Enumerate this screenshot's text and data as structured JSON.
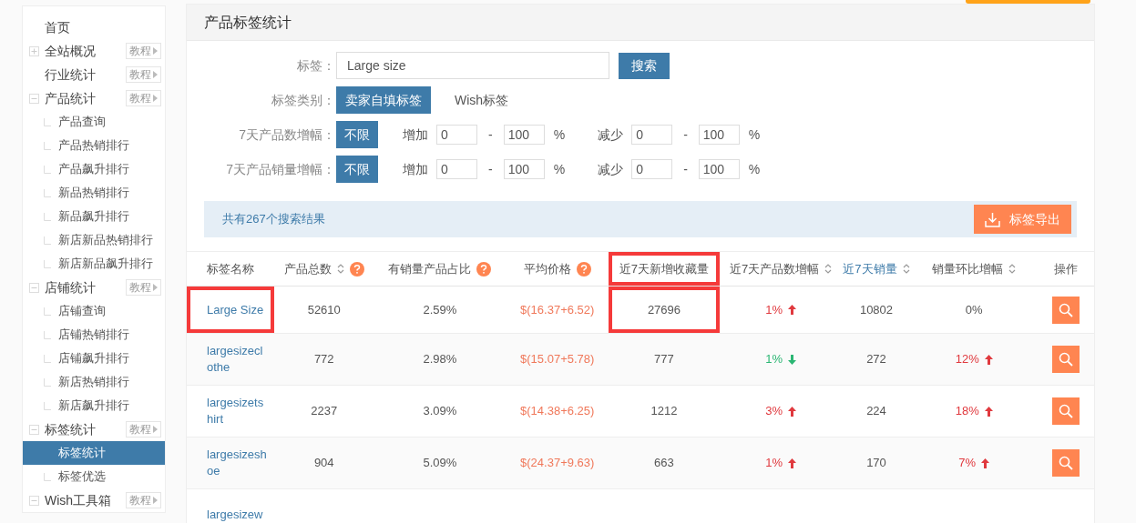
{
  "sidebar": {
    "items": [
      {
        "label": "首页",
        "selected": false
      },
      {
        "label": "全站概况",
        "expanded": false,
        "tutorial": "教程",
        "selected": false
      },
      {
        "label": "行业统计",
        "tutorial": "教程",
        "selected": false
      },
      {
        "label": "产品统计",
        "expanded": true,
        "tutorial": "教程",
        "selected": false,
        "children": [
          {
            "label": "产品查询",
            "selected": false
          },
          {
            "label": "产品热销排行",
            "selected": false
          },
          {
            "label": "产品飙升排行",
            "selected": false
          },
          {
            "label": "新品热销排行",
            "selected": false
          },
          {
            "label": "新品飙升排行",
            "selected": false
          },
          {
            "label": "新店新品热销排行",
            "selected": false
          },
          {
            "label": "新店新品飙升排行",
            "selected": false
          }
        ]
      },
      {
        "label": "店铺统计",
        "expanded": true,
        "tutorial": "教程",
        "selected": false,
        "children": [
          {
            "label": "店铺查询",
            "selected": false
          },
          {
            "label": "店铺热销排行",
            "selected": false
          },
          {
            "label": "店铺飙升排行",
            "selected": false
          },
          {
            "label": "新店热销排行",
            "selected": false
          },
          {
            "label": "新店飙升排行",
            "selected": false
          }
        ]
      },
      {
        "label": "标签统计",
        "expanded": true,
        "tutorial": "教程",
        "selected": false,
        "children": [
          {
            "label": "标签统计",
            "selected": true
          },
          {
            "label": "标签优选",
            "selected": false
          }
        ]
      },
      {
        "label": "Wish工具箱",
        "expanded": true,
        "tutorial": "教程",
        "selected": false
      }
    ]
  },
  "panel": {
    "title": "产品标签统计",
    "filters": {
      "tag_label": "标签：",
      "tag_value": "Large size",
      "search_button": "搜索",
      "category_label": "标签类别：",
      "categories": [
        {
          "label": "卖家自填标签",
          "selected": true
        },
        {
          "label": "Wish标签",
          "selected": false
        }
      ],
      "ranges": [
        {
          "label": "7天产品数增幅：",
          "unlimited": "不限",
          "unlimited_selected": true,
          "increase": "增加",
          "inc_from": "0",
          "inc_to": "100",
          "decrease": "减少",
          "dec_from": "0",
          "dec_to": "100",
          "dash": "-",
          "unit": "%"
        },
        {
          "label": "7天产品销量增幅：",
          "unlimited": "不限",
          "unlimited_selected": true,
          "increase": "增加",
          "inc_from": "0",
          "inc_to": "100",
          "decrease": "减少",
          "dec_from": "0",
          "dec_to": "100",
          "dash": "-",
          "unit": "%"
        }
      ]
    },
    "result_text": "共有267个搜索结果",
    "export_button": "标签导出",
    "table": {
      "columns": [
        {
          "label": "标签名称",
          "sortable": false,
          "help": false,
          "selected": false,
          "highlighted": false
        },
        {
          "label": "产品总数",
          "sortable": true,
          "help": true,
          "selected": false,
          "highlighted": false
        },
        {
          "label": "有销量产品占比",
          "sortable": false,
          "help": true,
          "selected": false,
          "highlighted": false
        },
        {
          "label": "平均价格",
          "sortable": false,
          "help": true,
          "selected": false,
          "highlighted": false
        },
        {
          "label": "近7天新增收藏量",
          "sortable": false,
          "help": false,
          "selected": false,
          "highlighted": true
        },
        {
          "label": "近7天产品数增幅",
          "sortable": true,
          "help": false,
          "selected": false,
          "highlighted": false
        },
        {
          "label": "近7天销量",
          "sortable": true,
          "help": false,
          "selected": true,
          "highlighted": false
        },
        {
          "label": "销量环比增幅",
          "sortable": true,
          "help": false,
          "selected": false,
          "highlighted": false
        },
        {
          "label": "操作",
          "sortable": false,
          "help": false,
          "selected": false,
          "highlighted": false
        }
      ],
      "rows": [
        {
          "name": "Large Size",
          "name_highlighted": true,
          "total": "52610",
          "ratio": "2.59%",
          "price": "$(16.37+6.52)",
          "favorites": "27696",
          "favorites_highlighted": true,
          "count_change": "1%",
          "count_rising": true,
          "sales": "10802",
          "sales_change": "0%"
        },
        {
          "name": "largesizeclothe",
          "name_highlighted": false,
          "total": "772",
          "ratio": "2.98%",
          "price": "$(15.07+5.78)",
          "favorites": "777",
          "favorites_highlighted": false,
          "count_change": "1%",
          "count_rising": false,
          "sales": "272",
          "sales_change": "12%",
          "sales_rising": true
        },
        {
          "name": "largesizetshirt",
          "name_highlighted": false,
          "total": "2237",
          "ratio": "3.09%",
          "price": "$(14.38+6.25)",
          "favorites": "1212",
          "favorites_highlighted": false,
          "count_change": "3%",
          "count_rising": true,
          "sales": "224",
          "sales_change": "18%",
          "sales_rising": true
        },
        {
          "name": "largesizeshoe",
          "name_highlighted": false,
          "total": "904",
          "ratio": "5.09%",
          "price": "$(24.37+9.63)",
          "favorites": "663",
          "favorites_highlighted": false,
          "count_change": "1%",
          "count_rising": true,
          "sales": "170",
          "sales_change": "7%",
          "sales_rising": true
        },
        {
          "name": "largesizew",
          "name_highlighted": false
        }
      ]
    }
  }
}
